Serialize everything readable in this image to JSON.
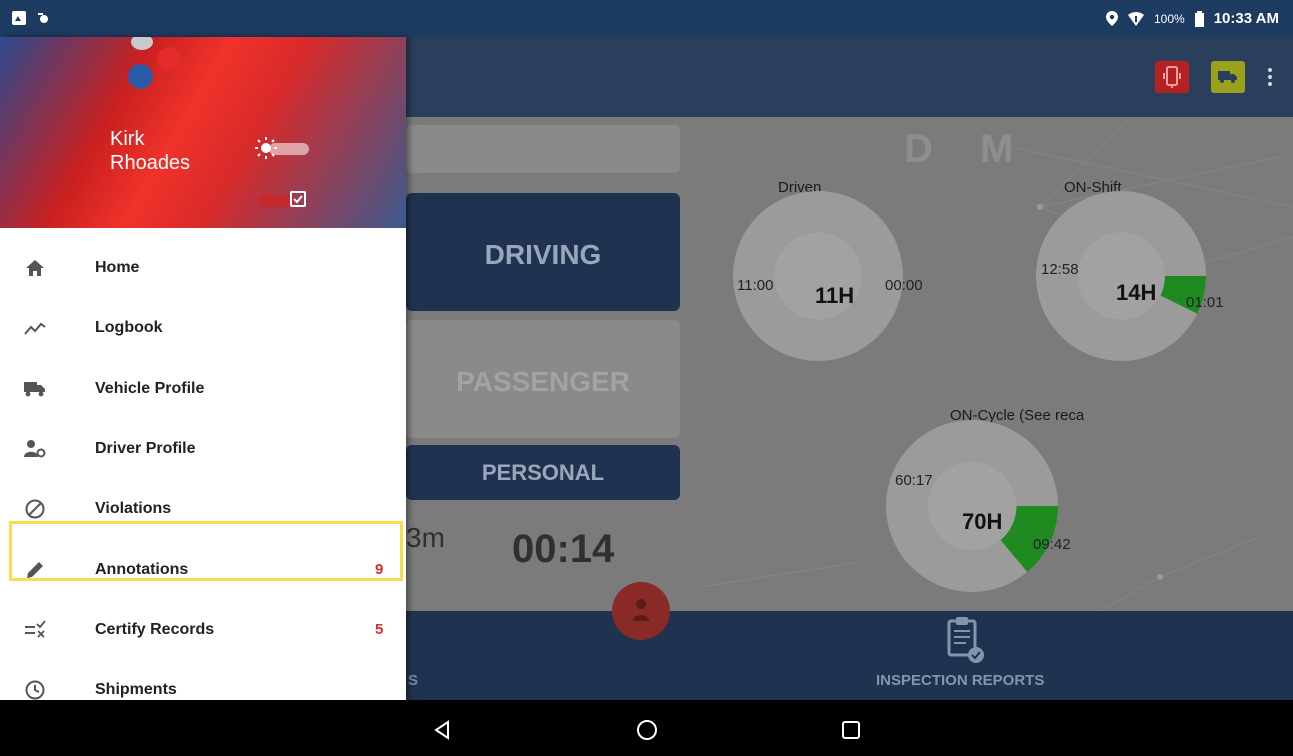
{
  "status_bar": {
    "battery": "100%",
    "time": "10:33 AM",
    "icons": [
      "gallery-icon",
      "notification-icon",
      "location-icon",
      "wifi-icon",
      "battery-icon"
    ]
  },
  "app_bar": {
    "actions": [
      "device-icon",
      "truck-icon",
      "more-options-icon"
    ],
    "colors": {
      "device": "#b52020",
      "truck": "#9aa11a"
    }
  },
  "dashboard": {
    "status_buttons": {
      "driving": "DRIVING",
      "passenger": "PASSENGER",
      "personal": "PERSONAL"
    },
    "timer_partial": "3m",
    "timer": "00:14",
    "dm_label": "D M",
    "gauges": [
      {
        "label": "Driven",
        "center": "11H",
        "left_value": "11:00",
        "right_value": "00:00",
        "used_fraction": 0
      },
      {
        "label": "ON-Shift",
        "center": "14H",
        "left_value": "12:58",
        "right_value": "01:01",
        "used_fraction": 0.073
      },
      {
        "label": "ON-Cycle (See reca",
        "center": "70H",
        "left_value": "60:17",
        "right_value": "09:42",
        "used_fraction": 0.139
      }
    ]
  },
  "bottom_nav": {
    "partial_tab": "S",
    "inspection": "INSPECTION REPORTS"
  },
  "drawer": {
    "user": {
      "first": "Kirk",
      "last": "Rhoades"
    },
    "menu": [
      {
        "label": "Home",
        "icon": "home-icon",
        "badge": ""
      },
      {
        "label": "Logbook",
        "icon": "logbook-icon",
        "badge": ""
      },
      {
        "label": "Vehicle Profile",
        "icon": "truck-icon",
        "badge": ""
      },
      {
        "label": "Driver Profile",
        "icon": "driver-settings-icon",
        "badge": ""
      },
      {
        "label": "Violations",
        "icon": "violations-icon",
        "badge": ""
      },
      {
        "label": "Annotations",
        "icon": "pencil-icon",
        "badge": "9"
      },
      {
        "label": "Certify Records",
        "icon": "certify-icon",
        "badge": "5"
      },
      {
        "label": "Shipments",
        "icon": "clock-icon",
        "badge": ""
      }
    ],
    "highlighted_item": "Violations"
  },
  "system_nav": [
    "back-icon",
    "home-circle-icon",
    "recents-icon"
  ]
}
